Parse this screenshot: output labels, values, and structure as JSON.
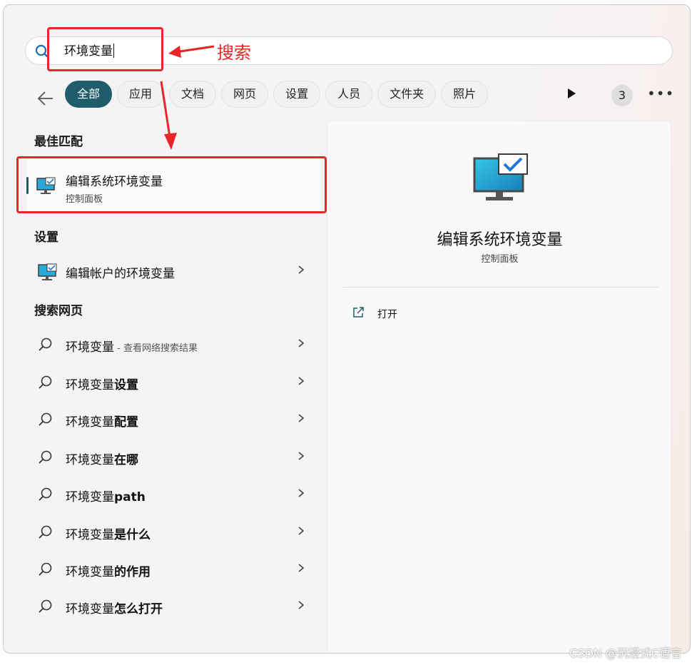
{
  "search": {
    "query": "环境变量"
  },
  "annotation": {
    "label": "搜索"
  },
  "filters": {
    "chips": [
      "全部",
      "应用",
      "文档",
      "网页",
      "设置",
      "人员",
      "文件夹",
      "照片"
    ],
    "badge_count": "3"
  },
  "best_match": {
    "heading": "最佳匹配",
    "title": "编辑系统环境变量",
    "subtitle": "控制面板"
  },
  "settings": {
    "heading": "设置",
    "items": [
      {
        "label": "编辑帐户的环境变量"
      }
    ]
  },
  "web": {
    "heading": "搜索网页",
    "first": {
      "query": "环境变量",
      "hint": " - 查看网络搜索结果"
    },
    "suggestions": [
      {
        "base": "环境变量",
        "suffix": "设置"
      },
      {
        "base": "环境变量",
        "suffix": "配置"
      },
      {
        "base": "环境变量",
        "suffix": "在哪"
      },
      {
        "base": "环境变量",
        "suffix": "path"
      },
      {
        "base": "环境变量",
        "suffix": "是什么"
      },
      {
        "base": "环境变量",
        "suffix": "的作用"
      },
      {
        "base": "环境变量",
        "suffix": "怎么打开"
      }
    ]
  },
  "preview": {
    "title": "编辑系统环境变量",
    "subtitle": "控制面板",
    "open_label": "打开"
  },
  "watermark": "CSDN @沉浸式C语言",
  "colors": {
    "accent": "#1f5d6c",
    "annotation": "#e8262a"
  }
}
